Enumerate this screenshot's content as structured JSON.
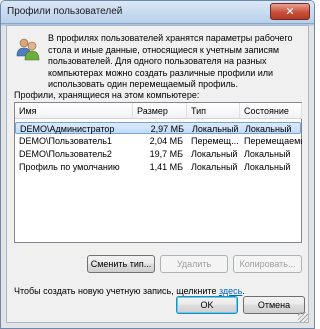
{
  "window": {
    "title": "Профили пользователей",
    "close_glyph": "✕"
  },
  "intro": {
    "text": "В профилях пользователей хранятся параметры рабочего стола и иные данные, относящиеся к учетным записям пользователей. Для одного пользователя на разных компьютерах можно создать различные профили или использовать один перемещаемый профиль."
  },
  "profiles": {
    "label": "Профили, хранящиеся на этом компьютере:",
    "columns": {
      "name": "Имя",
      "size": "Размер",
      "type": "Тип",
      "state": "Состояние"
    },
    "rows": [
      {
        "name": "DEMO\\Администратор",
        "size": "2,97 МБ",
        "type": "Локальный",
        "state": "Локальный",
        "selected": true
      },
      {
        "name": "DEMO\\Пользователь1",
        "size": "2,04 МБ",
        "type": "Перемещ...",
        "state": "Перемещаемый"
      },
      {
        "name": "DEMO\\Пользователь2",
        "size": "19,7 МБ",
        "type": "Локальный",
        "state": "Локальный"
      },
      {
        "name": "Профиль по умолчанию",
        "size": "1,41 МБ",
        "type": "Локальный",
        "state": "Локальный"
      }
    ]
  },
  "buttons": {
    "change_type": "Сменить тип...",
    "delete": "Удалить",
    "copy": "Копировать...",
    "ok": "OK",
    "cancel": "Отмена"
  },
  "create": {
    "prefix": "Чтобы создать новую учетную запись, щелкните",
    "link": "здесь",
    "suffix": "."
  },
  "icons": {
    "users": "users-icon",
    "close": "close-icon"
  }
}
